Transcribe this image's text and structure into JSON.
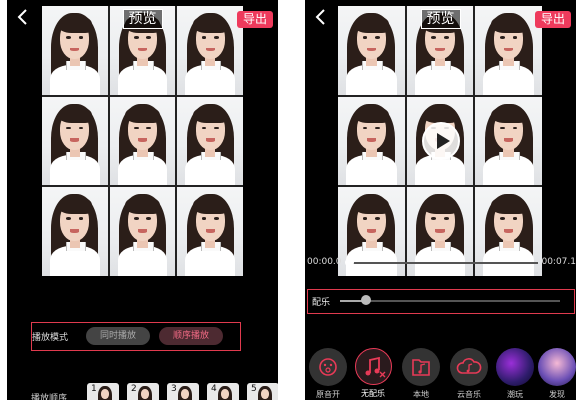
{
  "left": {
    "back_icon": "chevron-left-icon",
    "title": "预览",
    "export_label": "导出",
    "play_mode": {
      "label": "播放模式",
      "sync_label": "同时播放",
      "sequential_label": "顺序播放",
      "selected": "顺序播放"
    },
    "play_order": {
      "label": "播放顺序",
      "thumbs": [
        "1",
        "2",
        "3",
        "4",
        "5"
      ]
    }
  },
  "right": {
    "back_icon": "chevron-left-icon",
    "title": "预览",
    "export_label": "导出",
    "play_icon": "play-icon",
    "time_start": "00:00.0",
    "time_end": "00:07.1",
    "playback_progress": 0.0,
    "music_label": "配乐",
    "music_volume": 0.12,
    "music_options": [
      {
        "label": "原音开",
        "icon": "sound-face-icon"
      },
      {
        "label": "无配乐",
        "icon": "no-music-icon"
      },
      {
        "label": "本地",
        "icon": "folder-music-icon"
      },
      {
        "label": "云音乐",
        "icon": "cloud-music-icon"
      },
      {
        "label": "潮玩",
        "icon": "album-art-icon"
      },
      {
        "label": "发现",
        "icon": "album-art-icon"
      }
    ],
    "selected_music": "无配乐"
  },
  "colors": {
    "accent": "#ee3a5c",
    "background": "#000000"
  }
}
